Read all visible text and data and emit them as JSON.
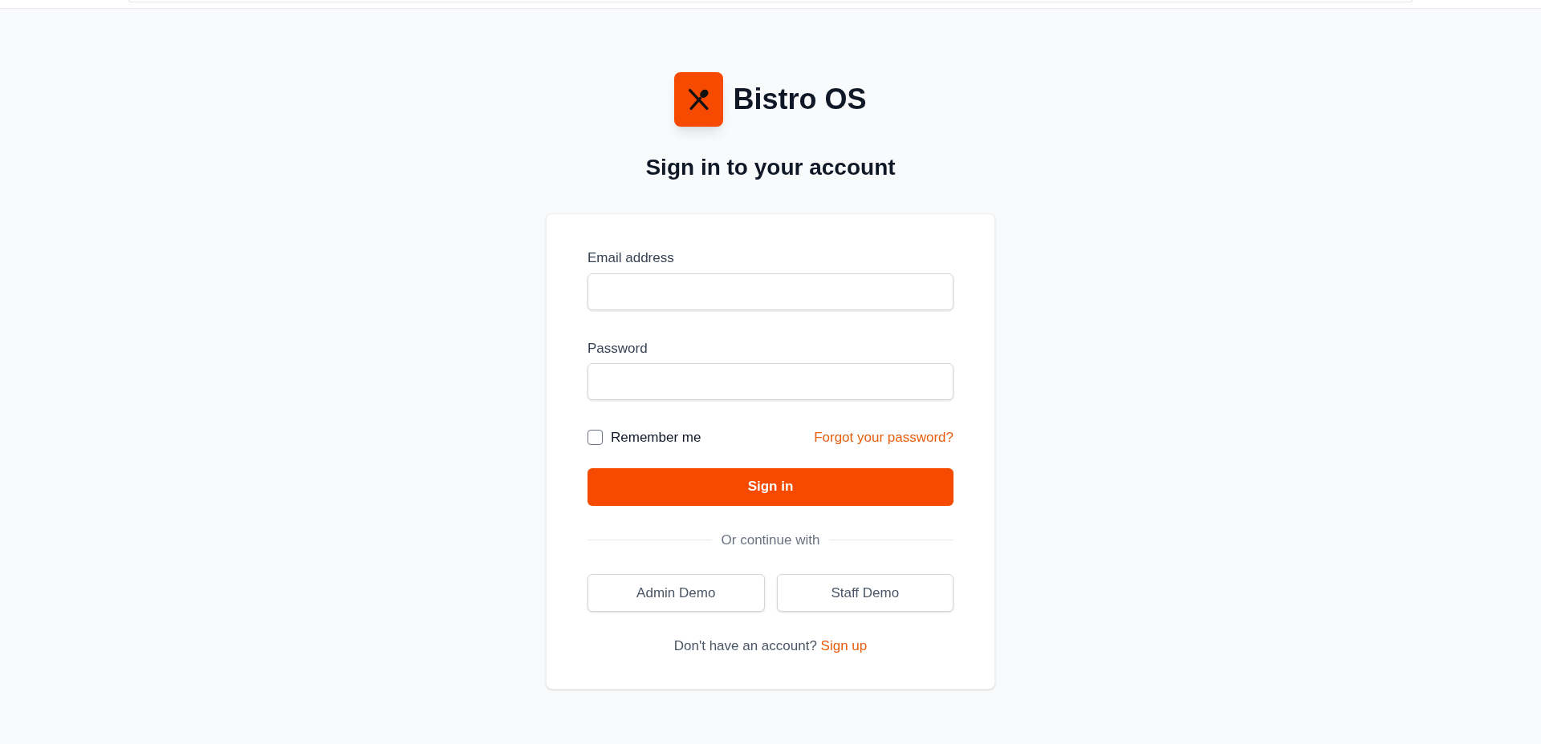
{
  "brand": {
    "name": "Bistro OS"
  },
  "heading": "Sign in to your account",
  "form": {
    "fields": [
      {
        "label": "Email address"
      },
      {
        "label": "Password"
      }
    ],
    "remember": {
      "label": "Remember me",
      "checked": false
    },
    "forgot_link": "Forgot your password?",
    "submit": "Sign in",
    "divider": "Or continue with",
    "demo_buttons": [
      "Admin Demo",
      "Staff Demo"
    ],
    "signup": {
      "prompt": "Don't have an account?",
      "link": "Sign up"
    }
  }
}
